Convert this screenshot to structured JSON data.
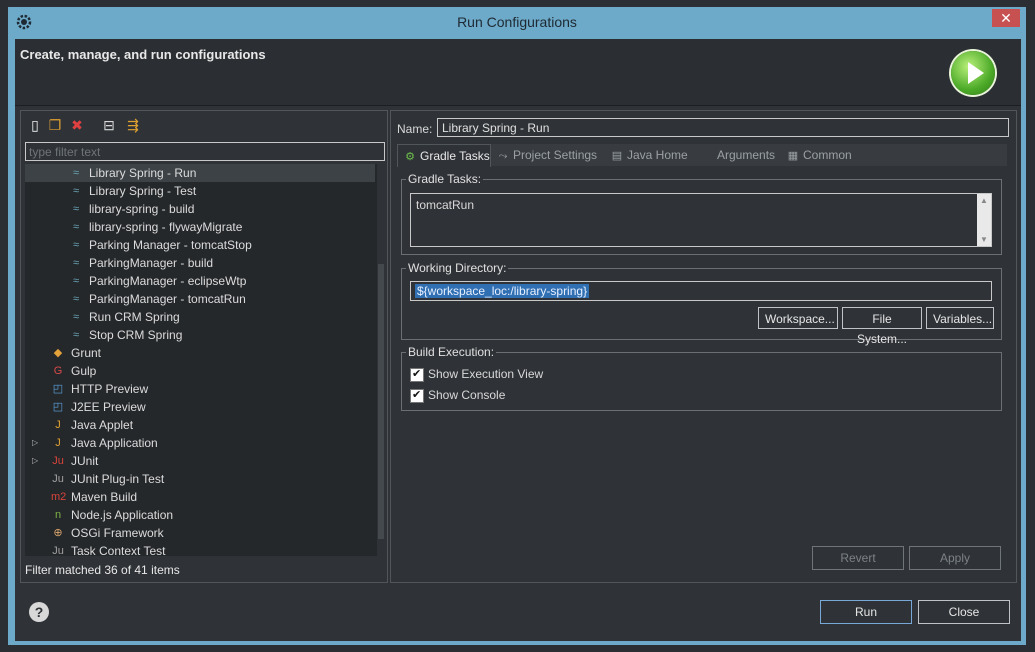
{
  "window": {
    "title": "Run Configurations",
    "close_glyph": "✕"
  },
  "header": {
    "title": "Create, manage, and run configurations",
    "banner_icon": "run-banner-icon"
  },
  "toolbar": {
    "icons": [
      "new-launch-config-icon",
      "duplicate-icon",
      "delete-icon",
      "collapse-all-icon",
      "filter-icon"
    ]
  },
  "filter": {
    "placeholder": "type filter text",
    "value": ""
  },
  "tree": {
    "items": [
      {
        "label": "Library Spring - Run",
        "level": 1,
        "icon": "gradle-icon",
        "selected": true
      },
      {
        "label": "Library Spring - Test",
        "level": 1,
        "icon": "gradle-icon"
      },
      {
        "label": "library-spring - build",
        "level": 1,
        "icon": "gradle-icon"
      },
      {
        "label": "library-spring - flywayMigrate",
        "level": 1,
        "icon": "gradle-icon"
      },
      {
        "label": "Parking Manager - tomcatStop",
        "level": 1,
        "icon": "gradle-icon"
      },
      {
        "label": "ParkingManager - build",
        "level": 1,
        "icon": "gradle-icon"
      },
      {
        "label": "ParkingManager - eclipseWtp",
        "level": 1,
        "icon": "gradle-icon"
      },
      {
        "label": "ParkingManager - tomcatRun",
        "level": 1,
        "icon": "gradle-icon"
      },
      {
        "label": "Run CRM Spring",
        "level": 1,
        "icon": "gradle-icon"
      },
      {
        "label": "Stop CRM Spring",
        "level": 1,
        "icon": "gradle-icon"
      },
      {
        "label": "Grunt",
        "level": 0,
        "icon": "grunt-icon"
      },
      {
        "label": "Gulp",
        "level": 0,
        "icon": "gulp-icon"
      },
      {
        "label": "HTTP Preview",
        "level": 0,
        "icon": "http-preview-icon"
      },
      {
        "label": "J2EE Preview",
        "level": 0,
        "icon": "j2ee-preview-icon"
      },
      {
        "label": "Java Applet",
        "level": 0,
        "icon": "java-applet-icon"
      },
      {
        "label": "Java Application",
        "level": 0,
        "icon": "java-application-icon",
        "expandable": true
      },
      {
        "label": "JUnit",
        "level": 0,
        "icon": "junit-icon",
        "expandable": true
      },
      {
        "label": "JUnit Plug-in Test",
        "level": 0,
        "icon": "junit-plugin-icon"
      },
      {
        "label": "Maven Build",
        "level": 0,
        "icon": "maven-icon"
      },
      {
        "label": "Node.js Application",
        "level": 0,
        "icon": "nodejs-icon"
      },
      {
        "label": "OSGi Framework",
        "level": 0,
        "icon": "osgi-icon"
      },
      {
        "label": "Task Context Test",
        "level": 0,
        "icon": "task-context-icon"
      }
    ]
  },
  "filter_status": "Filter matched 36 of 41 items",
  "config": {
    "name_label": "Name:",
    "name_value": "Library Spring - Run",
    "tabs": [
      {
        "label": "Gradle Tasks",
        "icon": "gradle-tasks-icon",
        "active": true
      },
      {
        "label": "Project Settings",
        "icon": "project-settings-icon"
      },
      {
        "label": "Java Home",
        "icon": "java-home-icon"
      },
      {
        "label": "Arguments",
        "icon": "arguments-icon"
      },
      {
        "label": "Common",
        "icon": "common-icon"
      }
    ],
    "gradle_tasks_legend": "Gradle Tasks:",
    "gradle_tasks_value": "tomcatRun",
    "working_dir_legend": "Working Directory:",
    "working_dir_value": "${workspace_loc:/library-spring}",
    "workspace_btn": "Workspace...",
    "filesystem_btn": "File System...",
    "variables_btn": "Variables...",
    "build_exec_legend": "Build Execution:",
    "show_execution_view": "Show Execution View",
    "show_console": "Show Console"
  },
  "actions": {
    "revert": "Revert",
    "apply": "Apply",
    "run": "Run",
    "close": "Close",
    "help": "?"
  }
}
